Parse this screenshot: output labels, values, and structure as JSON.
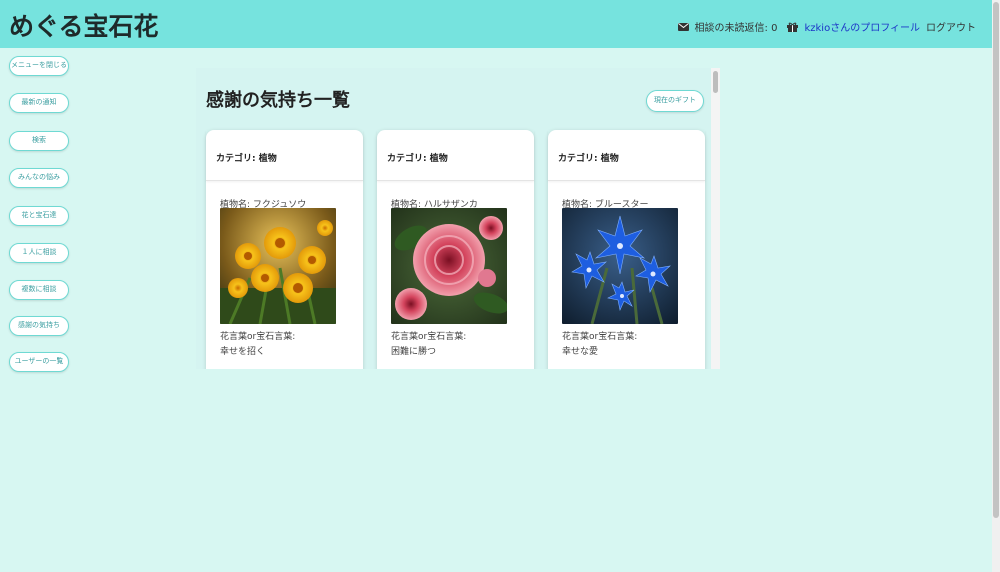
{
  "app": {
    "title": "めぐる宝石花"
  },
  "header": {
    "unread_label": "相談の未読返信: 0",
    "profile_label": "kzkioさんのプロフィール",
    "logout_label": "ログアウト"
  },
  "sidebar": {
    "items": [
      {
        "label": "メニューを閉じる"
      },
      {
        "label": "最新の通知"
      },
      {
        "label": "検索"
      },
      {
        "label": "みんなの悩み"
      },
      {
        "label": "花と宝石達"
      },
      {
        "label": "１人に相談"
      },
      {
        "label": "複数に相談"
      },
      {
        "label": "感謝の気持ち"
      },
      {
        "label": "ユーザーの一覧"
      }
    ]
  },
  "main": {
    "title": "感謝の気持ち一覧",
    "gift_button": "現在のギフト",
    "cards": [
      {
        "category": "カテゴリ: 植物",
        "plant": "植物名: フクジュソウ",
        "meaning_label": "花言葉or宝石言葉:",
        "meaning": "幸せを招く",
        "image_icon": "yellow-flower-image"
      },
      {
        "category": "カテゴリ: 植物",
        "plant": "植物名: ハルサザンカ",
        "meaning_label": "花言葉or宝石言葉:",
        "meaning": "困難に勝つ",
        "image_icon": "pink-camellia-image"
      },
      {
        "category": "カテゴリ: 植物",
        "plant": "植物名: ブルースター",
        "meaning_label": "花言葉or宝石言葉:",
        "meaning": "幸せな愛",
        "image_icon": "blue-star-flower-image"
      }
    ]
  },
  "colors": {
    "header_bg": "#76e3de",
    "page_bg": "#d7f7f2",
    "accent": "#6fd9d3",
    "link": "#1b34c7"
  }
}
